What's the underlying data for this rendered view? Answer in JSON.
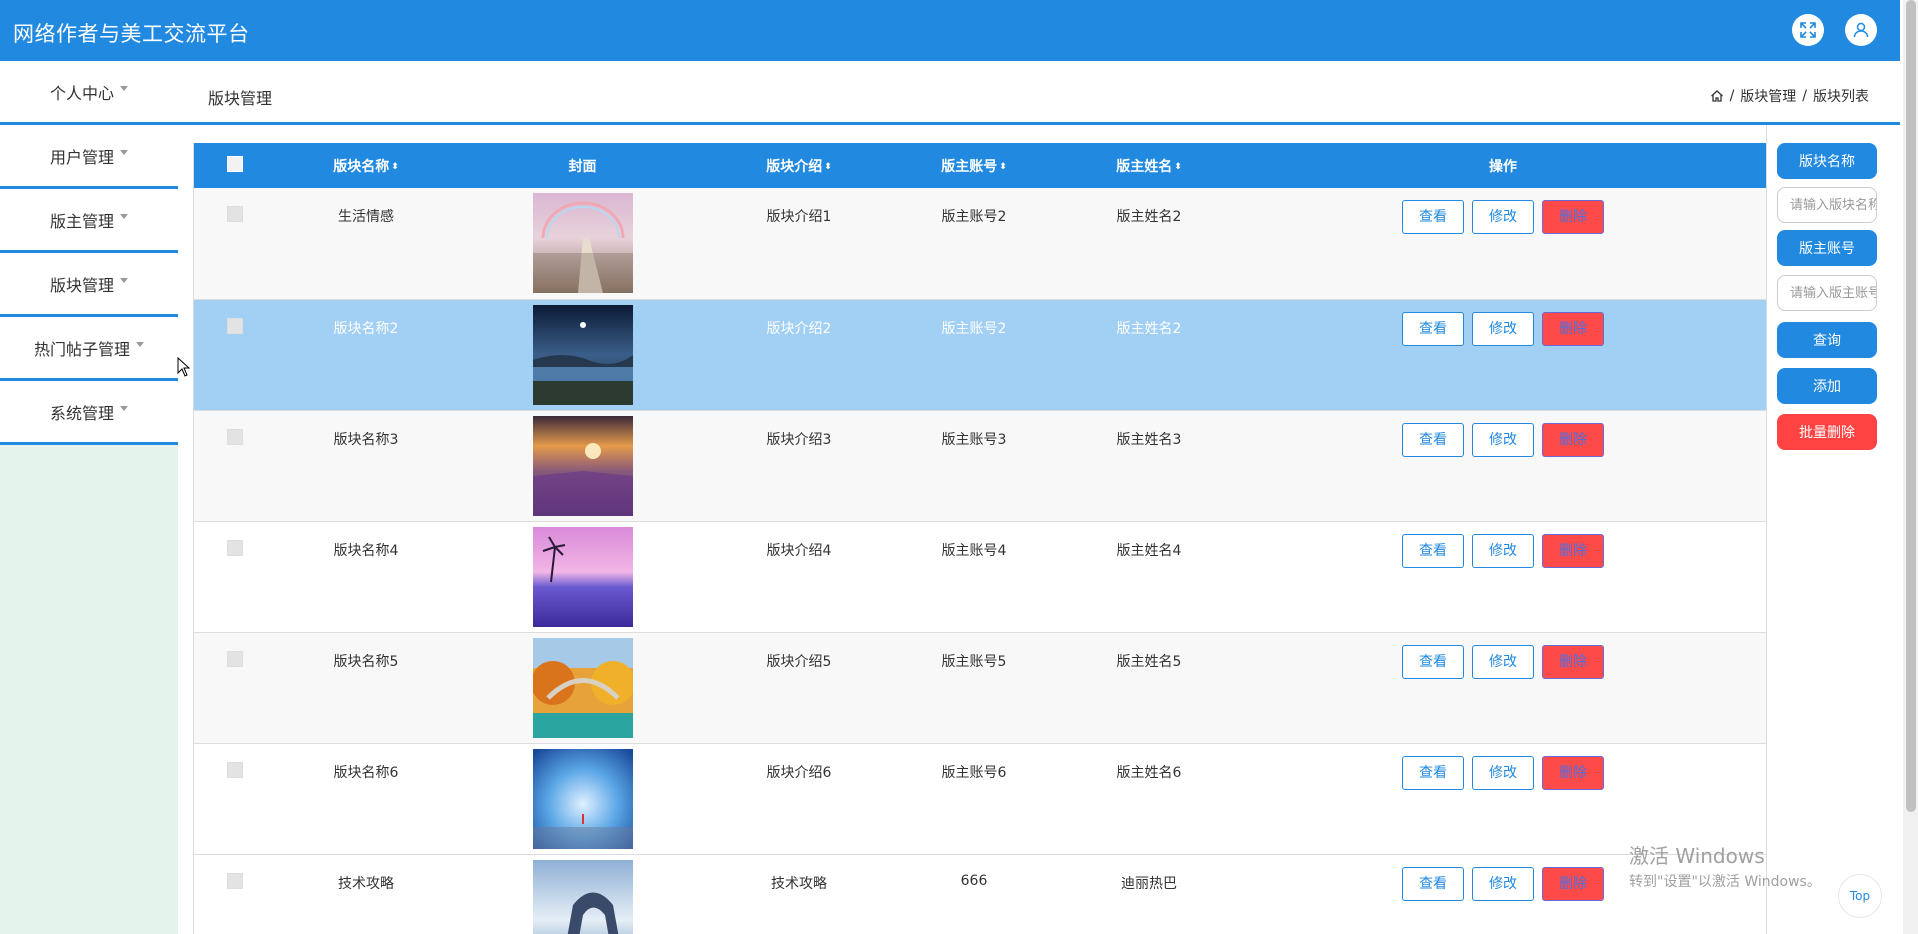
{
  "app": {
    "title": "网络作者与美工交流平台"
  },
  "topbar": {
    "fullscreen_icon": "expand-icon",
    "user_icon": "user-icon"
  },
  "sidebar": {
    "items": [
      {
        "label": "个人中心"
      },
      {
        "label": "用户管理"
      },
      {
        "label": "版主管理"
      },
      {
        "label": "版块管理"
      },
      {
        "label": "热门帖子管理"
      },
      {
        "label": "系统管理"
      }
    ]
  },
  "page": {
    "title": "版块管理",
    "breadcrumb": {
      "home_icon": "home-icon",
      "level1": "版块管理",
      "level2": "版块列表",
      "separator": "/"
    }
  },
  "table": {
    "headers": {
      "name": "版块名称",
      "cover": "封面",
      "intro": "版块介绍",
      "account": "版主账号",
      "moderator": "版主姓名",
      "ops": "操作"
    },
    "sort_icon": "⬍",
    "buttons": {
      "view": "查看",
      "edit": "修改",
      "delete": "删除"
    },
    "rows": [
      {
        "name": "生活情感",
        "intro": "版块介绍1",
        "account": "版主账号2",
        "moderator": "版主姓名2",
        "state": "alt"
      },
      {
        "name": "版块名称2",
        "intro": "版块介绍2",
        "account": "版主账号2",
        "moderator": "版主姓名2",
        "state": "selected"
      },
      {
        "name": "版块名称3",
        "intro": "版块介绍3",
        "account": "版主账号3",
        "moderator": "版主姓名3",
        "state": "alt"
      },
      {
        "name": "版块名称4",
        "intro": "版块介绍4",
        "account": "版主账号4",
        "moderator": "版主姓名4",
        "state": "normal"
      },
      {
        "name": "版块名称5",
        "intro": "版块介绍5",
        "account": "版主账号5",
        "moderator": "版主姓名5",
        "state": "alt"
      },
      {
        "name": "版块名称6",
        "intro": "版块介绍6",
        "account": "版主账号6",
        "moderator": "版主姓名6",
        "state": "normal"
      },
      {
        "name": "技术攻略",
        "intro": "技术攻略",
        "account": "666",
        "moderator": "迪丽热巴",
        "state": "normal"
      }
    ]
  },
  "search": {
    "name_label": "版块名称",
    "name_placeholder": "请输入版块名称",
    "account_label": "版主账号",
    "account_placeholder": "请输入版主账号",
    "query_button": "查询",
    "add_button": "添加",
    "batch_delete_button": "批量删除"
  },
  "watermark": {
    "line1": "激活 Windows",
    "line2": "转到\"设置\"以激活 Windows。"
  },
  "back_to_top": "Top",
  "colors": {
    "primary": "#2189e0",
    "danger": "#ff4a4a",
    "selected_row": "#a2cff4",
    "sidebar_bg": "#e4f3ec"
  }
}
